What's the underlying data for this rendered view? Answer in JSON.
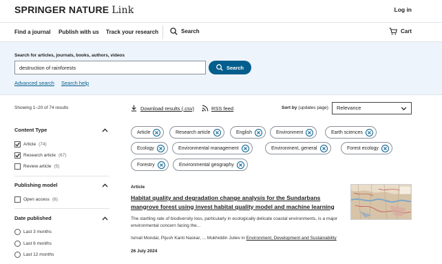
{
  "header": {
    "brand": "SPRINGER NATURE",
    "brand_suffix": "Link",
    "login": "Log in"
  },
  "nav": {
    "items": [
      "Find a journal",
      "Publish with us",
      "Track your research"
    ],
    "search": "Search",
    "cart": "Cart"
  },
  "search": {
    "label": "Search for articles, journals, books, authors, videos",
    "value": "destruction of rainforests",
    "button": "Search",
    "advanced": "Advanced search",
    "help": "Search help"
  },
  "toolbar": {
    "results_count": "Showing 1–20 of 74 results",
    "download": "Download results (.csv)",
    "rss": "RSS feed",
    "sort_by": "Sort by",
    "sort_note": "(updates page)",
    "sort_value": "Relevance"
  },
  "facets": {
    "content_type": {
      "title": "Content Type",
      "options": [
        {
          "label": "Article",
          "count": "(74)",
          "checked": true
        },
        {
          "label": "Research article",
          "count": "(67)",
          "checked": true
        },
        {
          "label": "Review article",
          "count": "(5)",
          "checked": false
        }
      ]
    },
    "publishing_model": {
      "title": "Publishing model",
      "options": [
        {
          "label": "Open access",
          "count": "(6)",
          "checked": false
        }
      ]
    },
    "date_published": {
      "title": "Date published",
      "options": [
        "Last 3 months",
        "Last 6 months",
        "Last 12 months"
      ]
    }
  },
  "chips": [
    "Article",
    "Research article",
    "English",
    "Environment",
    "Earth sciences",
    "Ecology",
    "Environmental management",
    "Environment, general",
    "Forest ecology",
    "Forestry",
    "Environmental geography"
  ],
  "result": {
    "type": "Article",
    "title": "Habitat quality and degradation change analysis for the Sundarbans mangrove forest using invest habitat quality model and machine learning",
    "snippet": "The startling rate of biodiversity loss, particularly in ecologically delicate coastal environments, is a major environmental concern facing the...",
    "authors": "Ismail Mondal, Pijush Kanti Naskar, ... Mukhiddin Juliev in ",
    "journal": "Environment, Development and Sustainability",
    "date": "26 July 2024"
  },
  "colors": {
    "accent": "#025e8d",
    "search_band": "#eef4fb"
  }
}
